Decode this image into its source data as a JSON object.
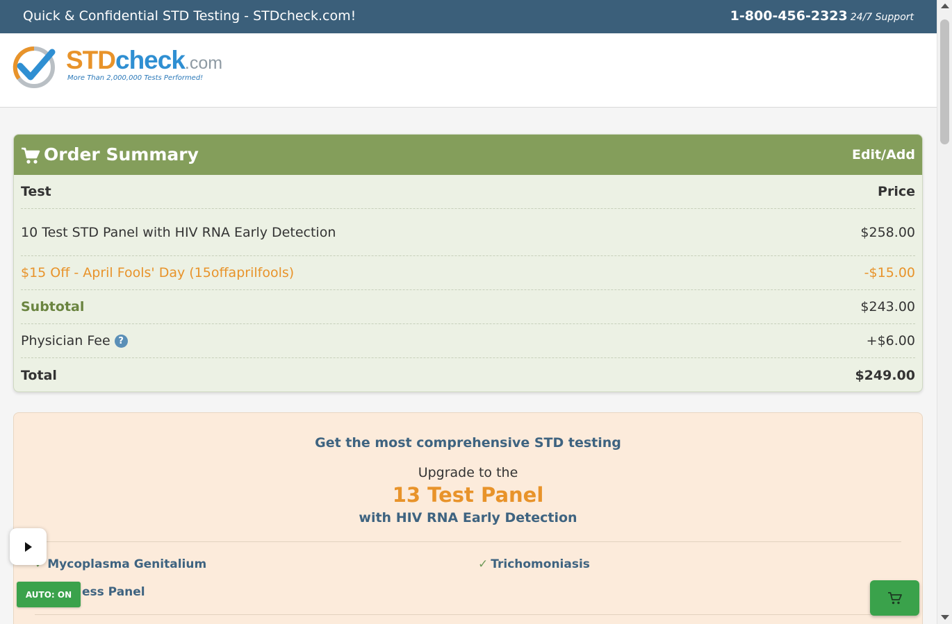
{
  "topbar": {
    "tagline": "Quick & Confidential STD Testing - STDcheck.com!",
    "phone": "1-800-456-2323",
    "support": "24/7 Support"
  },
  "logo": {
    "std": "STD",
    "check": "check",
    "com": ".com",
    "tagline": "More Than 2,000,000 Tests Performed!"
  },
  "order_summary": {
    "title": "Order Summary",
    "edit_label": "Edit/Add",
    "col_test": "Test",
    "col_price": "Price",
    "item_name": "10 Test STD Panel with HIV RNA Early Detection",
    "item_price": "$258.00",
    "discount_name": "$15 Off - April Fools' Day (15offaprilfools)",
    "discount_price": "-$15.00",
    "subtotal_label": "Subtotal",
    "subtotal_value": "$243.00",
    "fee_label": "Physician Fee",
    "fee_help": "?",
    "fee_value": "+$6.00",
    "total_label": "Total",
    "total_value": "$249.00"
  },
  "upgrade": {
    "heading": "Get the most comprehensive STD testing",
    "intro": "Upgrade to the",
    "panel": "13 Test Panel",
    "subtitle": "with HIV RNA Early Detection",
    "features": [
      "Mycoplasma Genitalium",
      "Trichomoniasis",
      "ess Panel"
    ]
  },
  "controls": {
    "auto_label": "AUTO: ON"
  },
  "colors": {
    "topbar": "#3b5f7a",
    "order_header": "#849e5b",
    "order_body": "#ecf1e4",
    "accent_orange": "#e8932a",
    "upgrade_bg": "#fcebdb",
    "button_green": "#3aa24b"
  },
  "icons": {
    "cart": "shopping-cart-icon",
    "help": "question-circle-icon",
    "check": "check-mark-icon",
    "play": "play-icon"
  }
}
